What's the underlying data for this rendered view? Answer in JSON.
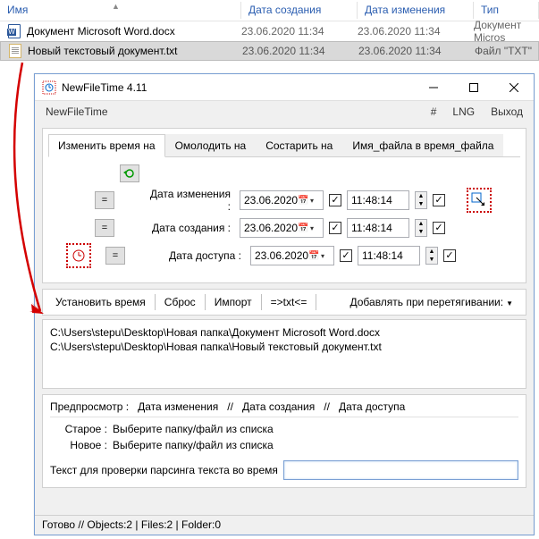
{
  "explorer": {
    "columns": {
      "name": "Имя",
      "created": "Дата создания",
      "modified": "Дата изменения",
      "type": "Тип"
    },
    "rows": [
      {
        "name": "Документ Microsoft Word.docx",
        "created": "23.06.2020 11:34",
        "modified": "23.06.2020 11:34",
        "type": "Документ Micros"
      },
      {
        "name": "Новый текстовый документ.txt",
        "created": "23.06.2020 11:34",
        "modified": "23.06.2020 11:34",
        "type": "Файл \"TXT\""
      }
    ]
  },
  "window": {
    "title": "NewFileTime 4.11",
    "menu": {
      "left": "NewFileTime",
      "hash": "#",
      "lng": "LNG",
      "exit": "Выход"
    },
    "tabs": {
      "change": "Изменить время на",
      "younger": "Омолодить на",
      "older": "Состарить на",
      "filename": "Имя_файла в время_файла"
    },
    "labels": {
      "modified": "Дата изменения :",
      "created": "Дата создания :",
      "accessed": "Дата доступа :",
      "eq": "="
    },
    "dates": {
      "modified": "23.06.2020",
      "created": "23.06.2020",
      "accessed": "23.06.2020"
    },
    "times": {
      "modified": "11:48:14",
      "created": "11:48:14",
      "accessed": "11:48:14"
    },
    "actions": {
      "set": "Установить время",
      "reset": "Сброс",
      "import": "Импорт",
      "txt": "=>txt<=",
      "drag": "Добавлять при перетягивании:"
    },
    "files": [
      "C:\\Users\\stepu\\Desktop\\Новая папка\\Документ Microsoft Word.docx",
      "C:\\Users\\stepu\\Desktop\\Новая папка\\Новый текстовый документ.txt"
    ],
    "preview": {
      "header_label": "Предпросмотр",
      "header_mod": "Дата изменения",
      "header_created": "Дата создания",
      "header_accessed": "Дата доступа",
      "sep": "//",
      "old_label": "Старое :",
      "new_label": "Новое :",
      "placeholder": "Выберите папку/файл из списка",
      "parse_label": "Текст для проверки парсинга текста во время"
    },
    "status": "Готово // Objects:2 | Files:2 | Folder:0"
  }
}
